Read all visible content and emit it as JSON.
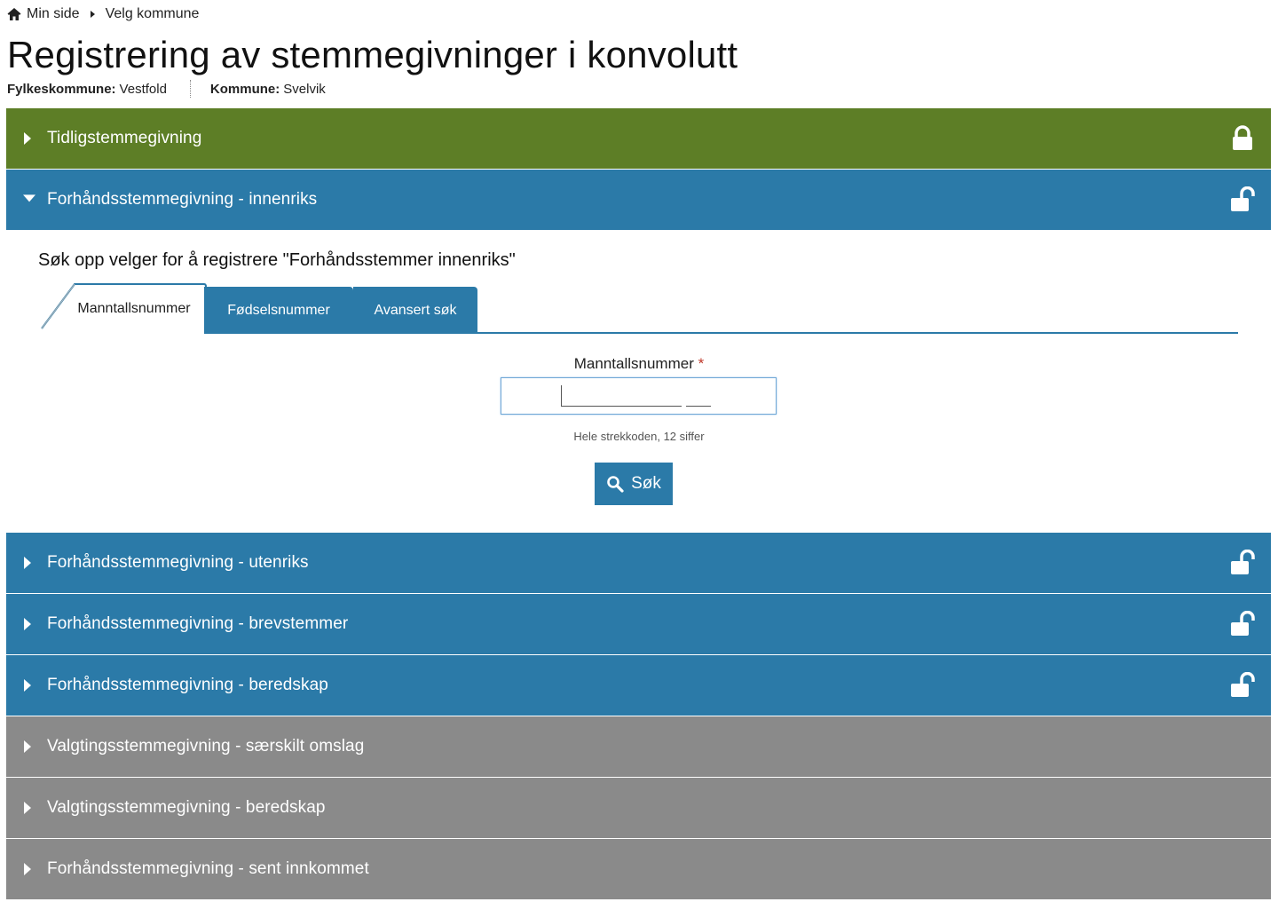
{
  "breadcrumb": {
    "home": "Min side",
    "current": "Velg kommune"
  },
  "page_title": "Registrering av stemmegivninger i konvolutt",
  "meta": {
    "county_label": "Fylkeskommune:",
    "county_value": "Vestfold",
    "municipality_label": "Kommune:",
    "municipality_value": "Svelvik"
  },
  "sections": [
    {
      "label": "Tidligstemmegivning",
      "color": "#5d7e26",
      "lock": "lock-closed-icon",
      "open": false
    },
    {
      "label": "Forhåndsstemmegivning - innenriks",
      "color": "#2b7aa8",
      "lock": "lock-open-icon",
      "open": true
    },
    {
      "label": "Forhåndsstemmegivning - utenriks",
      "color": "#2b7aa8",
      "lock": "lock-open-icon",
      "open": false
    },
    {
      "label": "Forhåndsstemmegivning - brevstemmer",
      "color": "#2b7aa8",
      "lock": "lock-open-icon",
      "open": false
    },
    {
      "label": "Forhåndsstemmegivning - beredskap",
      "color": "#2b7aa8",
      "lock": "lock-open-icon",
      "open": false
    },
    {
      "label": "Valgtingsstemmegivning - særskilt omslag",
      "color": "#8a8a8a",
      "lock": "",
      "open": false
    },
    {
      "label": "Valgtingsstemmegivning - beredskap",
      "color": "#8a8a8a",
      "lock": "",
      "open": false
    },
    {
      "label": "Forhåndsstemmegivning - sent innkommet",
      "color": "#8a8a8a",
      "lock": "",
      "open": false
    }
  ],
  "panel": {
    "heading": "Søk opp velger for å registrere \"Forhåndsstemmer innenriks\"",
    "tabs": [
      {
        "label": "Manntallsnummer",
        "active": true
      },
      {
        "label": "Fødselsnummer",
        "active": false
      },
      {
        "label": "Avansert søk",
        "active": false
      }
    ],
    "field_label": "Manntallsnummer",
    "required_mark": "*",
    "field_value": "",
    "field_hint": "Hele strekkoden, 12 siffer",
    "search_label": "Søk"
  }
}
